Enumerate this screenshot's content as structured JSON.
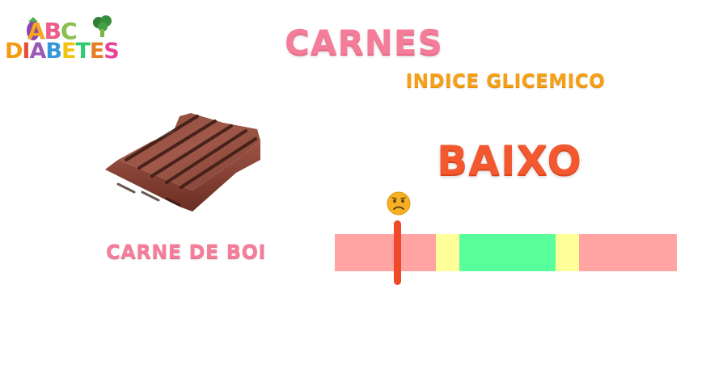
{
  "logo": {
    "line1": [
      "A",
      "B",
      "C"
    ],
    "line1_colors": [
      "#f5a623",
      "#f25c8a",
      "#8bc34a"
    ],
    "line2": [
      "D",
      "I",
      "A",
      "B",
      "E",
      "T",
      "E",
      "S"
    ],
    "line2_colors": [
      "#f39c12",
      "#e74c3c",
      "#9b59b6",
      "#3498db",
      "#f1c40f",
      "#2ecc71",
      "#e67e22",
      "#e84393"
    ]
  },
  "header": {
    "title": "CARNES",
    "subtitle": "INDICE GLICEMICO"
  },
  "result": {
    "level": "BAIXO",
    "level_color": "#f3582f"
  },
  "food": {
    "label": "CARNE DE BOI",
    "image_icon": "steak-image"
  },
  "scale": {
    "segments": [
      {
        "name": "red-left",
        "color": "#ffa3a3",
        "fraction": 0.295
      },
      {
        "name": "yellow-left",
        "color": "#ffff99",
        "fraction": 0.07
      },
      {
        "name": "green",
        "color": "#58ff9a",
        "fraction": 0.28
      },
      {
        "name": "yellow-right",
        "color": "#ffff99",
        "fraction": 0.07
      },
      {
        "name": "red-right",
        "color": "#ffa3a3",
        "fraction": 0.285
      }
    ],
    "marker_position": 0.18,
    "marker_color": "#f04a2a",
    "indicator_icon": "worried-face-icon"
  }
}
